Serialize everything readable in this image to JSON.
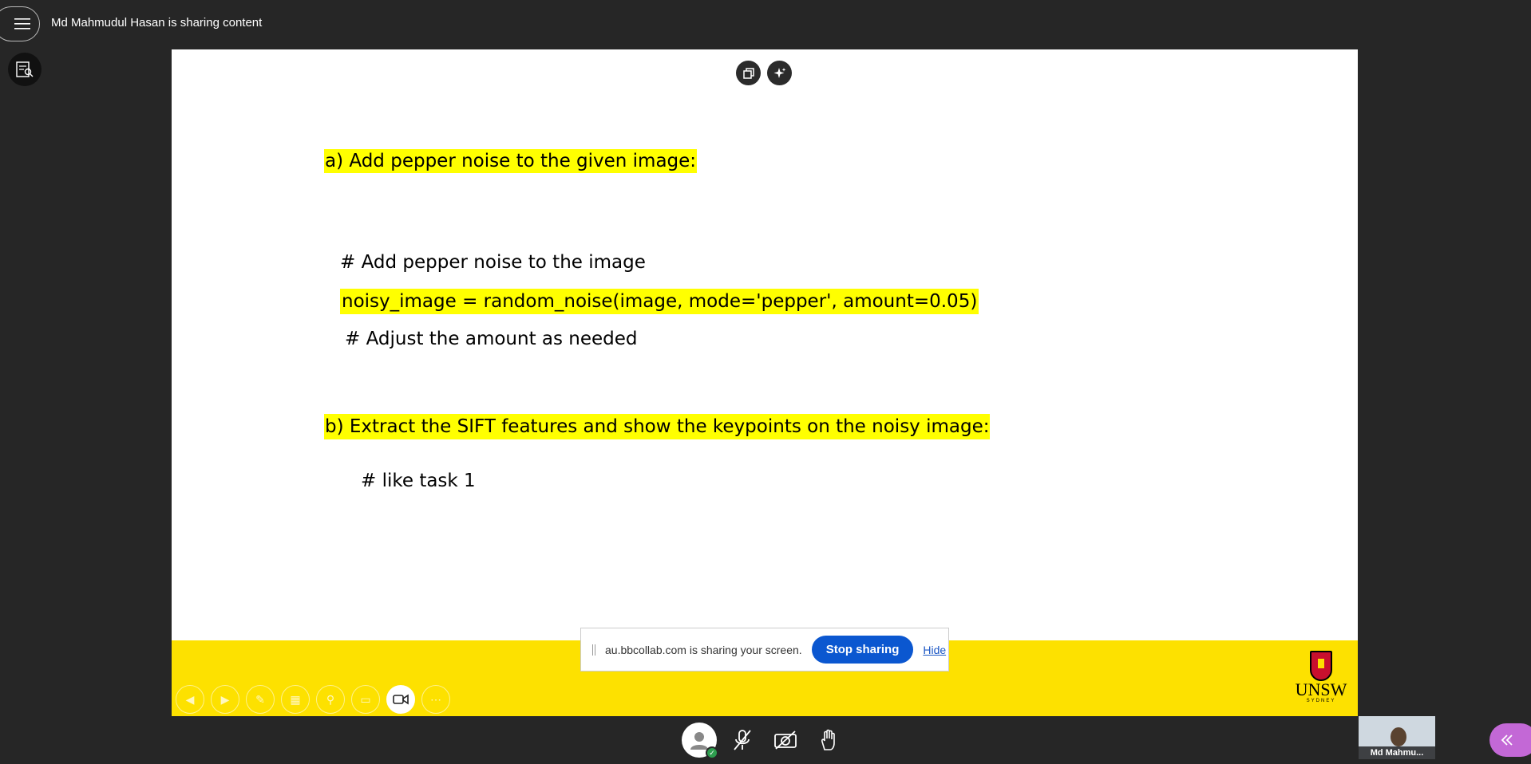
{
  "header": {
    "sharing_title": "Md Mahmudul Hasan is sharing content"
  },
  "slide": {
    "heading_a": "a) Add pepper noise to the given image:",
    "code_line_1": "# Add pepper noise to the image",
    "code_line_2": "noisy_image = random_noise(image, mode='pepper', amount=0.05)",
    "code_line_3": "# Adjust the amount as needed",
    "heading_b": "b) Extract the SIFT features and show the keypoints on the noisy image:",
    "code_line_4": "# like task 1"
  },
  "share_bar": {
    "message": "au.bbcollab.com is sharing your screen.",
    "stop_label": "Stop sharing",
    "hide_label": "Hide"
  },
  "logo": {
    "name": "UNSW",
    "sub": "SYDNEY"
  },
  "video": {
    "participant_name": "Md Mahmu..."
  },
  "colors": {
    "highlight": "#ffff00",
    "footer": "#fde100",
    "stop_button": "#0b57d0",
    "collapse_button": "#c368d6",
    "background": "#262626"
  },
  "icons": [
    "menu-icon",
    "transcript-icon",
    "copy-icon",
    "sparkle-icon",
    "prev-slide-icon",
    "next-slide-icon",
    "pen-icon",
    "layout-icon",
    "zoom-icon",
    "subtitles-icon",
    "video-camera-icon",
    "more-icon",
    "avatar-icon",
    "mic-off-icon",
    "camera-off-icon",
    "raise-hand-icon",
    "chevron-left-double-icon"
  ]
}
